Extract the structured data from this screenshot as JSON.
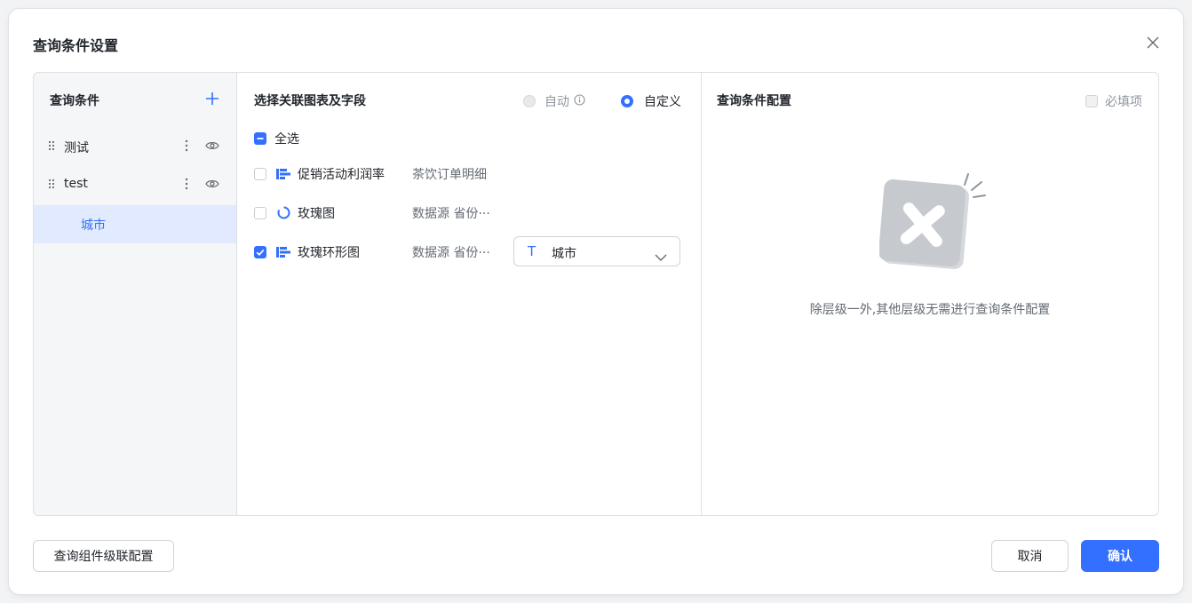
{
  "dialog": {
    "title": "查询条件设置",
    "close_icon": "close-icon"
  },
  "left": {
    "title": "查询条件",
    "add_icon": "plus-icon",
    "items": [
      {
        "label": "测试"
      },
      {
        "label": "test"
      }
    ],
    "sub_item": {
      "label": "城市"
    }
  },
  "middle": {
    "title": "选择关联图表及字段",
    "mode": {
      "auto_label": "自动",
      "custom_label": "自定义",
      "selected": "自定义"
    },
    "select_all": "全选",
    "rows": [
      {
        "name": "促销活动利润率",
        "meta": "茶饮订单明细",
        "icon": "bar-chart-icon",
        "checked": false
      },
      {
        "name": "玫瑰图",
        "meta": "数据源 省份···",
        "icon": "ring-chart-icon",
        "checked": false
      },
      {
        "name": "玫瑰环形图",
        "meta": "数据源 省份···",
        "icon": "bar-chart-icon",
        "checked": true,
        "field": "城市"
      }
    ]
  },
  "right": {
    "title": "查询条件配置",
    "required_label": "必填项",
    "empty_text": "除层级一外,其他层级无需进行查询条件配置"
  },
  "footer": {
    "cascade_button": "查询组件级联配置",
    "cancel_button": "取消",
    "confirm_button": "确认"
  },
  "colors": {
    "accent": "#3370ff",
    "selected_bg": "#e1eaff"
  }
}
